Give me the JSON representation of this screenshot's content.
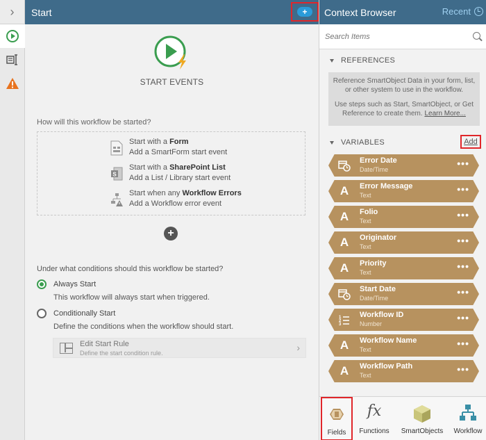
{
  "start_panel": {
    "title": "Start",
    "start_events_title": "START EVENTS",
    "question_started": "How will this workflow be started?",
    "options": [
      {
        "prefix": "Start with a ",
        "bold": "Form",
        "desc": "Add a SmartForm start event",
        "icon": "form-icon"
      },
      {
        "prefix": "Start with a ",
        "bold": "SharePoint List",
        "desc": "Add a List / Library start event",
        "icon": "sharepoint-icon"
      },
      {
        "prefix": "Start when any ",
        "bold": "Workflow Errors",
        "desc": "Add a Workflow error event",
        "icon": "workflow-error-icon"
      }
    ],
    "question_conditions": "Under what conditions should this workflow be started?",
    "always_start": {
      "label": "Always Start",
      "desc": "This workflow will always start when triggered.",
      "selected": true
    },
    "conditional_start": {
      "label": "Conditionally Start",
      "desc": "Define the conditions when the workflow should start.",
      "selected": false
    },
    "edit_rule": {
      "title": "Edit Start Rule",
      "subtitle": "Define the start condition rule."
    }
  },
  "context_browser": {
    "title": "Context Browser",
    "recent_label": "Recent",
    "search_placeholder": "Search Items",
    "references": {
      "header": "REFERENCES",
      "text1": "Reference SmartObject Data in your form, list, or other system to use in the workflow.",
      "text2": "Use steps such as Start, SmartObject, or Get Reference to create them.",
      "learn_more": "Learn More..."
    },
    "variables": {
      "header": "VARIABLES",
      "add_label": "Add",
      "items": [
        {
          "name": "Error Date",
          "type": "Date/Time",
          "glyph": "date"
        },
        {
          "name": "Error Message",
          "type": "Text",
          "glyph": "A"
        },
        {
          "name": "Folio",
          "type": "Text",
          "glyph": "A"
        },
        {
          "name": "Originator",
          "type": "Text",
          "glyph": "A"
        },
        {
          "name": "Priority",
          "type": "Text",
          "glyph": "A"
        },
        {
          "name": "Start Date",
          "type": "Date/Time",
          "glyph": "date"
        },
        {
          "name": "Workflow ID",
          "type": "Number",
          "glyph": "number"
        },
        {
          "name": "Workflow Name",
          "type": "Text",
          "glyph": "A"
        },
        {
          "name": "Workflow Path",
          "type": "Text",
          "glyph": "A"
        }
      ],
      "more_label": "•••"
    },
    "tabs": [
      {
        "label": "Fields",
        "icon": "fields-icon",
        "active": true
      },
      {
        "label": "Functions",
        "icon": "functions-icon",
        "active": false
      },
      {
        "label": "SmartObjects",
        "icon": "smartobjects-icon",
        "active": false
      },
      {
        "label": "Workflow",
        "icon": "workflow-icon",
        "active": false
      }
    ],
    "functions_glyph": "fx"
  },
  "colors": {
    "header_bg": "#3f6b8a",
    "variable_bg": "#b7925f",
    "start_green": "#3a9d4f",
    "highlight_red": "#e0262a"
  }
}
